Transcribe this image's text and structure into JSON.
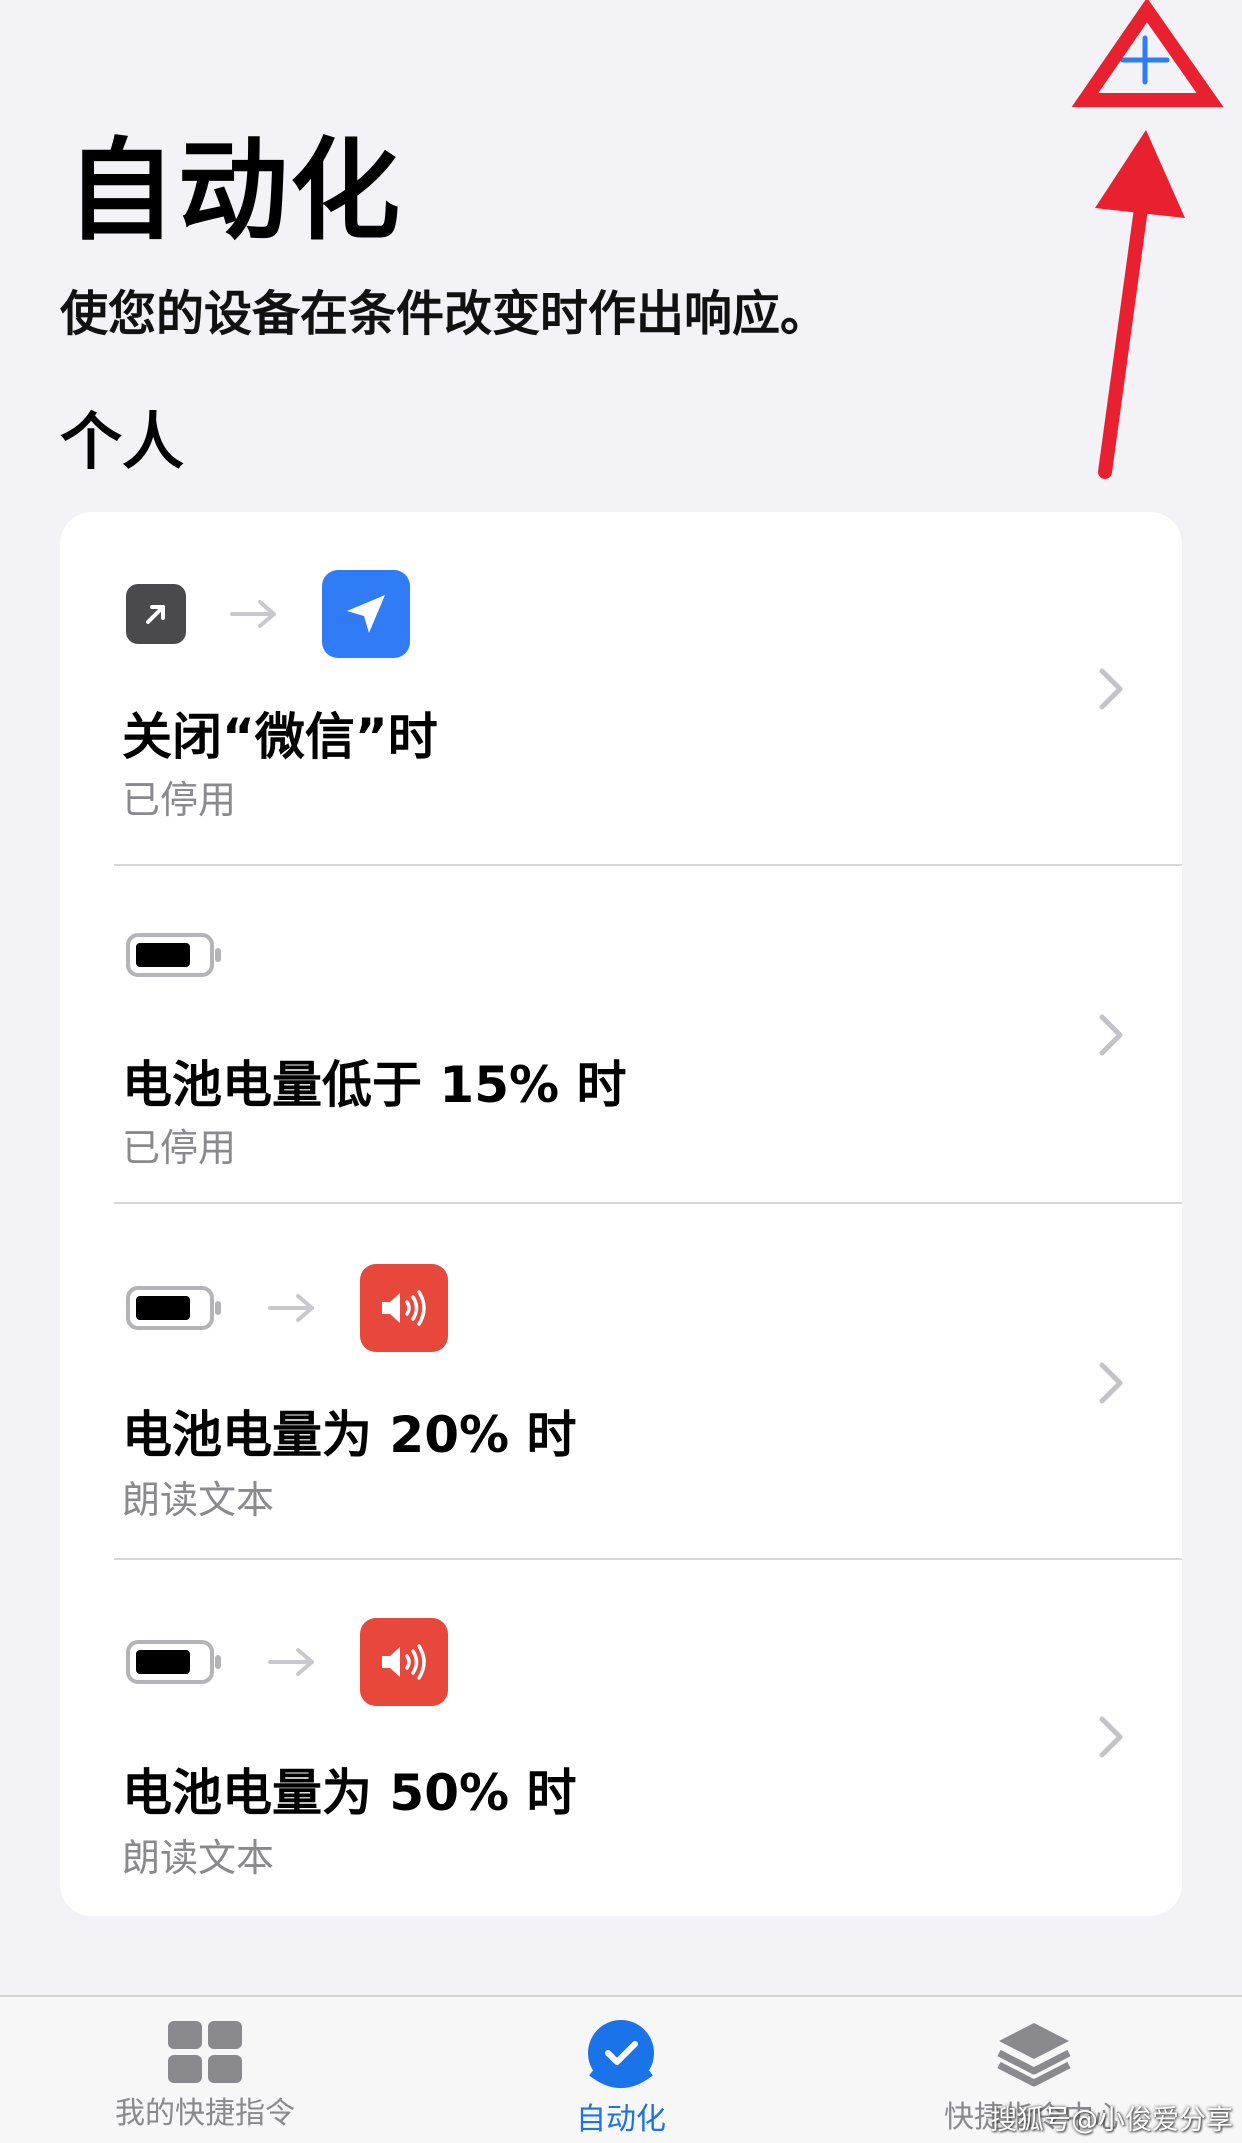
{
  "header": {
    "add_label": "+",
    "title": "自动化",
    "subtitle": "使您的设备在条件改变时作出响应。"
  },
  "section": {
    "title": "个人"
  },
  "automations": [
    {
      "title": "关闭“微信”时",
      "status": "已停用",
      "trigger_icon": "app-arrow-icon",
      "action_icon": "location-arrow-icon"
    },
    {
      "title": "电池电量低于 15% 时",
      "status": "已停用",
      "trigger_icon": "battery-icon"
    },
    {
      "title": "电池电量为 20% 时",
      "status": "朗读文本",
      "trigger_icon": "battery-icon",
      "action_icon": "speaker-icon"
    },
    {
      "title": "电池电量为 50% 时",
      "status": "朗读文本",
      "trigger_icon": "battery-icon",
      "action_icon": "speaker-icon"
    }
  ],
  "tabbar": {
    "tabs": [
      {
        "label": "我的快捷指令",
        "icon": "grid-icon",
        "active": false
      },
      {
        "label": "自动化",
        "icon": "checkmark-circle-icon",
        "active": true
      },
      {
        "label": "快捷指令中心",
        "icon": "stack-icon",
        "active": false
      }
    ]
  },
  "watermark": "搜狐号@小俊爱分享",
  "colors": {
    "accent": "#1a73e8",
    "annotation": "#e8202f",
    "location_tile": "#2f7cf6",
    "speaker_tile": "#e8473c",
    "app_tile": "#4a4a4c"
  }
}
